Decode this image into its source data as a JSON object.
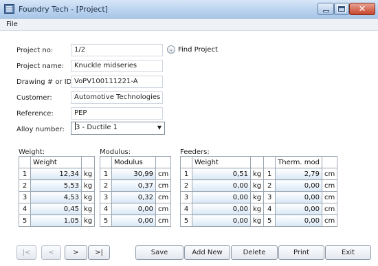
{
  "window": {
    "title": "Foundry Tech - [Project]",
    "close_glyph": "✕"
  },
  "menu": {
    "file": "File"
  },
  "form": {
    "project_no_label": "Project no:",
    "project_no_value": "1/2",
    "find_project_label": "Find Project",
    "find_icon_glyph": "⌄",
    "project_name_label": "Project name:",
    "project_name_value": "Knuckle midseries",
    "drawing_label": "Drawing # or ID:",
    "drawing_value": "VoPV100111221-A",
    "customer_label": "Customer:",
    "customer_value": "Automotive Technologies",
    "reference_label": "Reference:",
    "reference_value": "PEP",
    "alloy_label": "Alloy number:",
    "alloy_value": "3 - Ductile 1",
    "alloy_arrow": "▼"
  },
  "weight": {
    "section_label": "Weight:",
    "column_header": "Weight",
    "unit": "kg",
    "rows": [
      {
        "n": "1",
        "value": "12,34"
      },
      {
        "n": "2",
        "value": "5,53"
      },
      {
        "n": "3",
        "value": "4,53"
      },
      {
        "n": "4",
        "value": "0,45"
      },
      {
        "n": "5",
        "value": "1,05"
      }
    ]
  },
  "modulus": {
    "section_label": "Modulus:",
    "column_header": "Modulus",
    "unit": "cm",
    "rows": [
      {
        "n": "1",
        "value": "30,99"
      },
      {
        "n": "2",
        "value": "0,37"
      },
      {
        "n": "3",
        "value": "0,32"
      },
      {
        "n": "4",
        "value": "0,00"
      },
      {
        "n": "5",
        "value": "0,00"
      }
    ]
  },
  "feeders": {
    "section_label": "Feeders:",
    "weight_header": "Weight",
    "therm_header": "Therm. mod",
    "weight_unit": "kg",
    "therm_unit": "cm",
    "rows": [
      {
        "n": "1",
        "weight": "0,51",
        "m": "1",
        "therm": "2,79"
      },
      {
        "n": "2",
        "weight": "0,00",
        "m": "2",
        "therm": "0,00"
      },
      {
        "n": "3",
        "weight": "0,00",
        "m": "3",
        "therm": "0,00"
      },
      {
        "n": "4",
        "weight": "0,00",
        "m": "4",
        "therm": "0,00"
      },
      {
        "n": "5",
        "weight": "0,00",
        "m": "5",
        "therm": "0,00"
      }
    ]
  },
  "nav": {
    "first": "|<",
    "prev": "<",
    "next": ">",
    "last": ">|"
  },
  "actions": {
    "save": "Save",
    "add_new": "Add New",
    "delete": "Delete",
    "print": "Print",
    "exit": "Exit"
  }
}
